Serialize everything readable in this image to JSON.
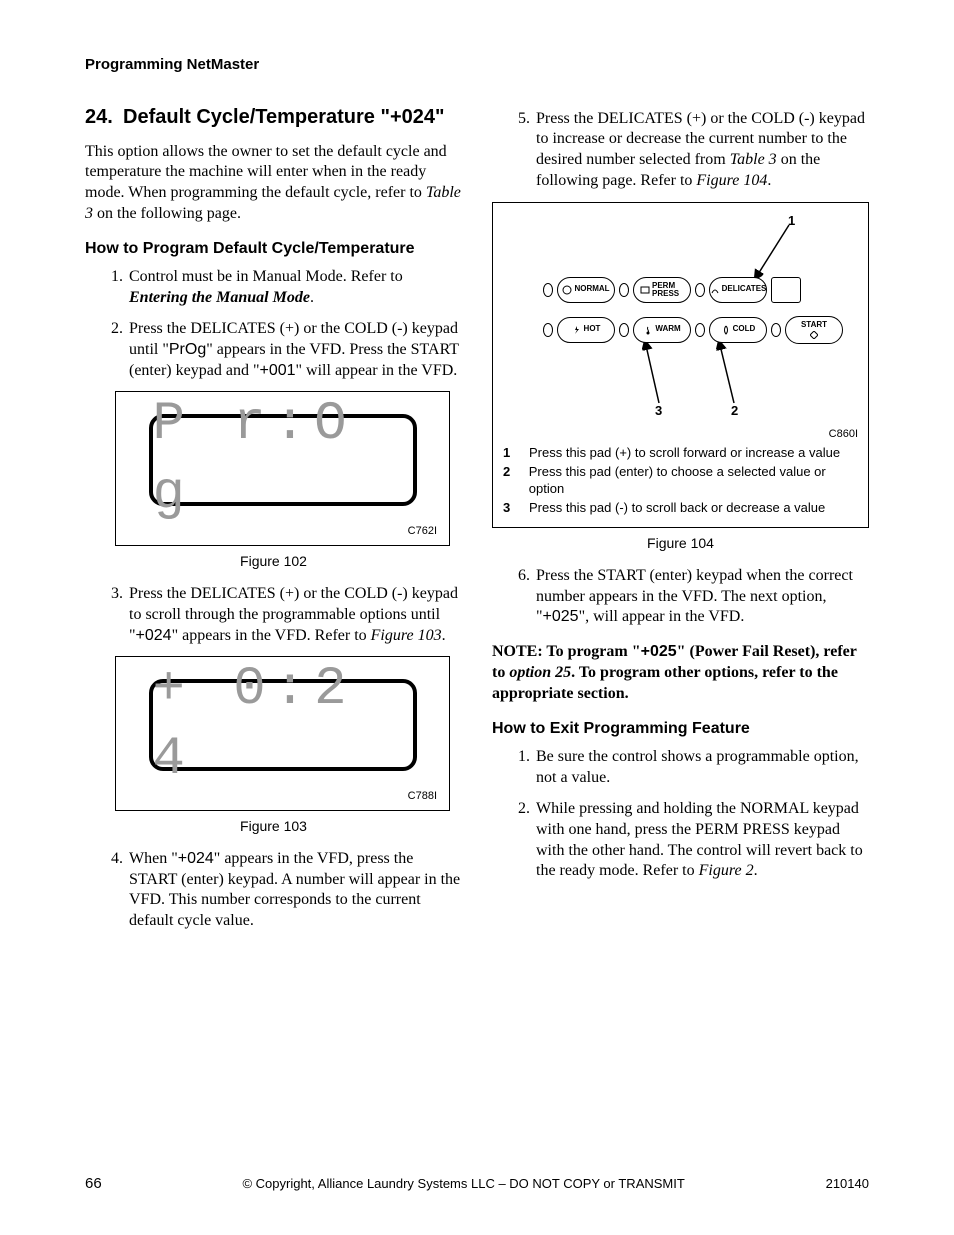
{
  "header": {
    "running": "Programming NetMaster"
  },
  "section": {
    "number": "24.",
    "title": "Default Cycle/Temperature \"+024\""
  },
  "intro": "This option allows the owner to set the default cycle and temperature the machine will enter when in the ready mode. When programming the default cycle, refer to Table 3 on the following page.",
  "intro_ref": "Table 3",
  "sub1": "How to Program Default Cycle/Temperature",
  "steps_a": {
    "s1_a": "Control must be in Manual Mode. Refer to ",
    "s1_b": "Entering the Manual Mode",
    "s1_c": ".",
    "s2_a": "Press the DELICATES (+) or the COLD (-) keypad until \"",
    "s2_code1": "PrOg",
    "s2_b": "\" appears in the VFD. Press the START (enter) keypad and \"",
    "s2_code2": "+001",
    "s2_c": "\" will appear in the VFD.",
    "s3_a": "Press the DELICATES (+) or the COLD (-) keypad to scroll through the programmable options until \"",
    "s3_code": "+024",
    "s3_b": "\" appears in the VFD. Refer to ",
    "s3_ref": "Figure 103",
    "s3_c": ".",
    "s4_a": "When \"",
    "s4_code": "+024",
    "s4_b": "\" appears in the VFD, press the START (enter) keypad. A number will appear in the VFD. This number corresponds to the current default cycle value."
  },
  "fig102": {
    "display": "P r:O g",
    "id": "C762I",
    "caption": "Figure 102"
  },
  "fig103": {
    "display": "+ 0:2 4",
    "id": "C788I",
    "caption": "Figure 103"
  },
  "steps_b": {
    "s5_a": "Press the DELICATES (+) or the COLD (-) keypad to increase or decrease the current number to the desired number selected from ",
    "s5_ref1": "Table 3",
    "s5_b": " on the following page. Refer to ",
    "s5_ref2": "Figure 104",
    "s5_c": ".",
    "s6_a": "Press the START (enter) keypad when the correct number appears in the VFD. The next option, \"",
    "s6_code": "+025",
    "s6_b": "\", will appear in the VFD."
  },
  "fig104": {
    "id": "C860I",
    "caption": "Figure 104",
    "callouts": {
      "c1": "1",
      "c2": "2",
      "c3": "3"
    },
    "buttons": {
      "normal": "NORMAL",
      "perm": "PERM PRESS",
      "delicates": "DELICATES",
      "hot": "HOT",
      "warm": "WARM",
      "cold": "COLD",
      "start": "START"
    },
    "legend": {
      "l1": "Press this pad (+) to scroll forward or increase a value",
      "l2": "Press this pad (enter) to choose a selected value or option",
      "l3": "Press this pad (-) to scroll back or decrease a value"
    }
  },
  "note": {
    "a": "NOTE: To program \"",
    "code": "+025",
    "b": "\" (Power Fail Reset), refer to ",
    "ref": "option 25",
    "c": ". To program other options, refer to the appropriate section."
  },
  "sub2": "How to Exit Programming Feature",
  "exit": {
    "e1": "Be sure the control shows a programmable option, not a value.",
    "e2_a": "While pressing and holding the NORMAL keypad with one hand, press the PERM PRESS keypad with the other hand. The control will revert back to the ready mode. Refer to ",
    "e2_ref": "Figure 2",
    "e2_b": "."
  },
  "footer": {
    "page": "66",
    "copyright": "© Copyright, Alliance Laundry Systems LLC – DO NOT COPY or TRANSMIT",
    "doc": "210140"
  }
}
